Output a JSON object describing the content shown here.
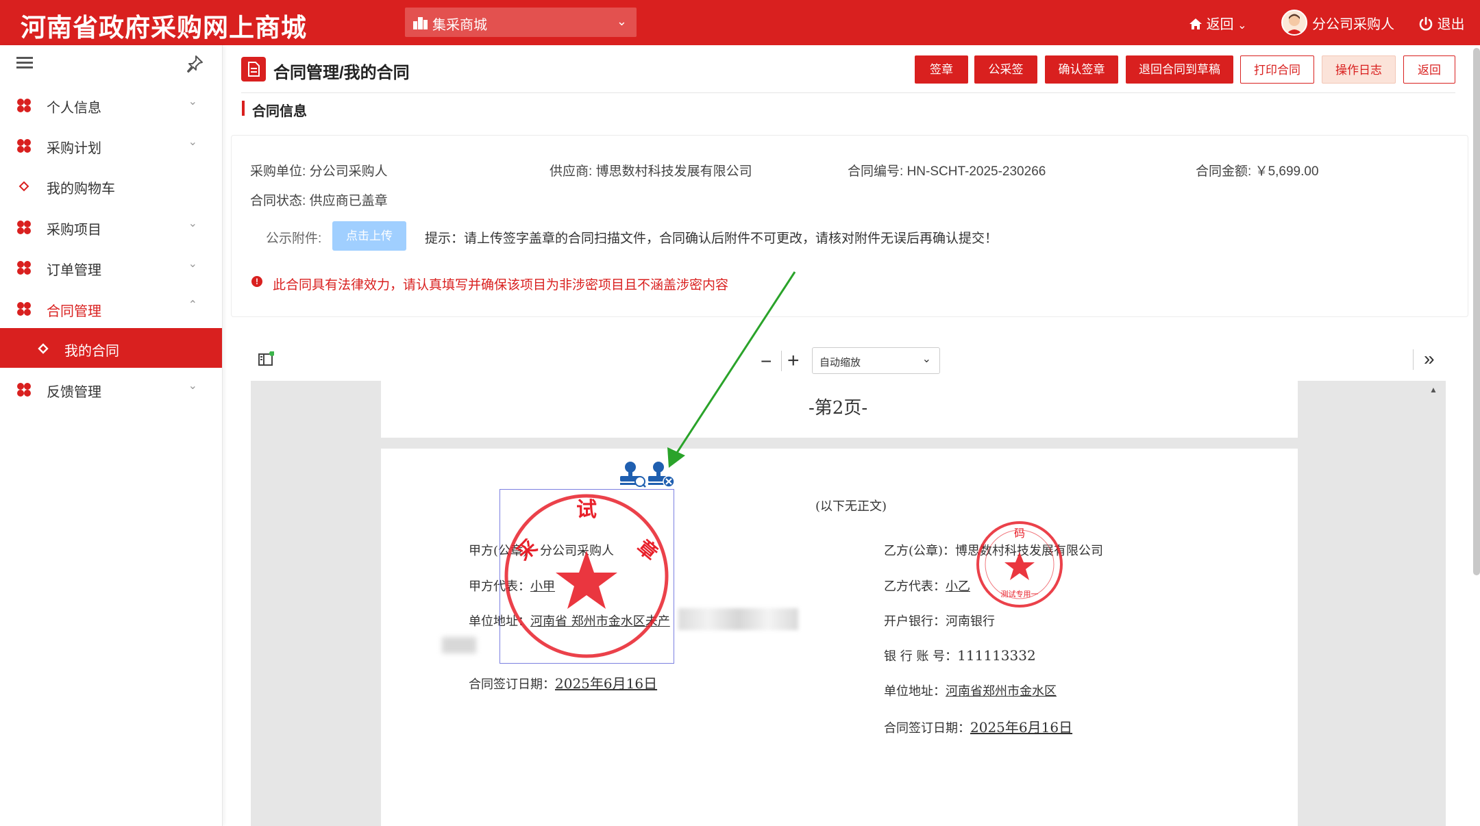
{
  "header": {
    "site_title": "河南省政府采购网上商城",
    "mall_select": "集采商城",
    "back": "返回",
    "user_name": "分公司采购人",
    "logout": "退出"
  },
  "sidebar": {
    "items": [
      {
        "label": "个人信息"
      },
      {
        "label": "采购计划"
      },
      {
        "label": "我的购物车"
      },
      {
        "label": "采购项目"
      },
      {
        "label": "订单管理"
      },
      {
        "label": "合同管理"
      },
      {
        "label": "我的合同"
      },
      {
        "label": "反馈管理"
      }
    ]
  },
  "page": {
    "title": "合同管理/我的合同",
    "buttons": {
      "sign": "签章",
      "public_sign": "公采签",
      "confirm_sign": "确认签章",
      "return_draft": "退回合同到草稿",
      "print": "打印合同",
      "log": "操作日志",
      "back": "返回"
    },
    "section_title": "合同信息"
  },
  "contract": {
    "buyer_label": "采购单位:",
    "buyer": "分公司采购人",
    "supplier_label": "供应商:",
    "supplier": "博思数村科技发展有限公司",
    "number_label": "合同编号:",
    "number": "HN-SCHT-2025-230266",
    "amount_label": "合同金额:",
    "amount": "￥5,699.00",
    "status_label": "合同状态:",
    "status": "供应商已盖章",
    "attachment_label": "公示附件:",
    "upload_button": "点击上传",
    "hint": "提示：请上传签字盖章的合同扫描文件，合同确认后附件不可更改，请核对附件无误后再确认提交！",
    "warning": "此合同具有法律效力，请认真填写并确保该项目为非涉密项目且不涵盖涉密内容"
  },
  "pdf": {
    "zoom": "自动缩放",
    "page_label": "-第2页-",
    "no_text": "(以下无正文)",
    "party_a": {
      "label": "甲方(公章)：",
      "name": "分公司采购人",
      "rep_label": "甲方代表：",
      "rep": "小甲",
      "addr_label": "单位地址：",
      "addr": "河南省 郑州市金水区未产",
      "date_label": "合同签订日期：",
      "date": "2025年6月16日"
    },
    "party_b": {
      "label": "乙方(公章)：",
      "name": "博思数村科技发展有限公司",
      "rep_label": "乙方代表：",
      "rep": "小乙",
      "bank_label": "开户银行：",
      "bank": "河南银行",
      "account_label": "银 行 账 号：",
      "account": "111113332",
      "addr_label": "单位地址：",
      "addr": "河南省郑州市金水区",
      "date_label": "合同签订日期：",
      "date": "2025年6月16日"
    },
    "seal_a": {
      "top": "试",
      "left": "采",
      "right": "章"
    },
    "seal_b": {
      "top": "码",
      "bottom": "测试专用一"
    }
  },
  "colors": {
    "primary": "#d9201f",
    "upload": "#a0cfff",
    "arrow": "#2aa32a"
  }
}
